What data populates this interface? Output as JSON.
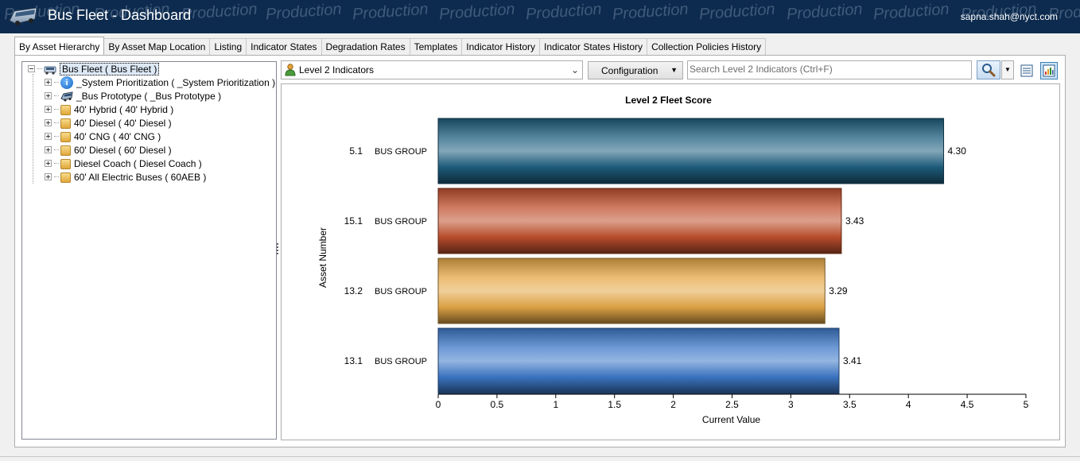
{
  "titlebar": {
    "title": "Bus Fleet - Dashboard",
    "user": "sapna.shah@nyct.com",
    "watermark": "Production",
    "background_color": "#0d2b4e"
  },
  "tabs": [
    {
      "label": "By Asset Hierarchy",
      "active": true
    },
    {
      "label": "By Asset Map Location"
    },
    {
      "label": "Listing"
    },
    {
      "label": "Indicator States"
    },
    {
      "label": "Degradation Rates"
    },
    {
      "label": "Templates"
    },
    {
      "label": "Indicator History"
    },
    {
      "label": "Indicator States History"
    },
    {
      "label": "Collection Policies History"
    }
  ],
  "tree": {
    "root": {
      "label": "Bus Fleet  ( Bus Fleet )",
      "icon": "bus-icon",
      "expanded": true,
      "selected": true
    },
    "children": [
      {
        "label": "_System Prioritization  ( _System Prioritization )",
        "icon": "info-icon"
      },
      {
        "label": "_Bus Prototype  ( _Bus Prototype )",
        "icon": "bus-icon"
      },
      {
        "label": "40' Hybrid  ( 40' Hybrid )",
        "icon": "folder-icon"
      },
      {
        "label": "40' Diesel  ( 40' Diesel )",
        "icon": "folder-icon"
      },
      {
        "label": "40' CNG  ( 40' CNG )",
        "icon": "folder-icon"
      },
      {
        "label": "60' Diesel  ( 60' Diesel )",
        "icon": "folder-icon"
      },
      {
        "label": "Diesel Coach  ( Diesel Coach )",
        "icon": "folder-icon"
      },
      {
        "label": "60' All Electric Buses  ( 60AEB )",
        "icon": "folder-icon"
      }
    ]
  },
  "toolbar": {
    "indicator_level": "Level 2 Indicators",
    "configuration_label": "Configuration",
    "search_placeholder": "Search Level 2 Indicators  (Ctrl+F)"
  },
  "chart_data": {
    "type": "bar",
    "orientation": "horizontal",
    "title": "Level 2 Fleet Score",
    "xlabel": "Current Value",
    "ylabel": "Asset Number",
    "xlim": [
      0,
      5
    ],
    "xticks": [
      "0",
      "0.5",
      "1",
      "1.5",
      "2",
      "2.5",
      "3",
      "3.5",
      "4",
      "4.5",
      "5"
    ],
    "grid": false,
    "legend": "none",
    "categories": [
      {
        "number": "5.1",
        "name": "BUS GROUP"
      },
      {
        "number": "15.1",
        "name": "BUS GROUP"
      },
      {
        "number": "13.2",
        "name": "BUS GROUP"
      },
      {
        "number": "13.1",
        "name": "BUS GROUP"
      }
    ],
    "values": [
      4.3,
      3.43,
      3.29,
      3.41
    ],
    "value_labels": [
      "4.30",
      "3.43",
      "3.29",
      "3.41"
    ],
    "colors": [
      "#1e5f7f",
      "#c0502e",
      "#e6a848",
      "#3d78c8"
    ]
  }
}
